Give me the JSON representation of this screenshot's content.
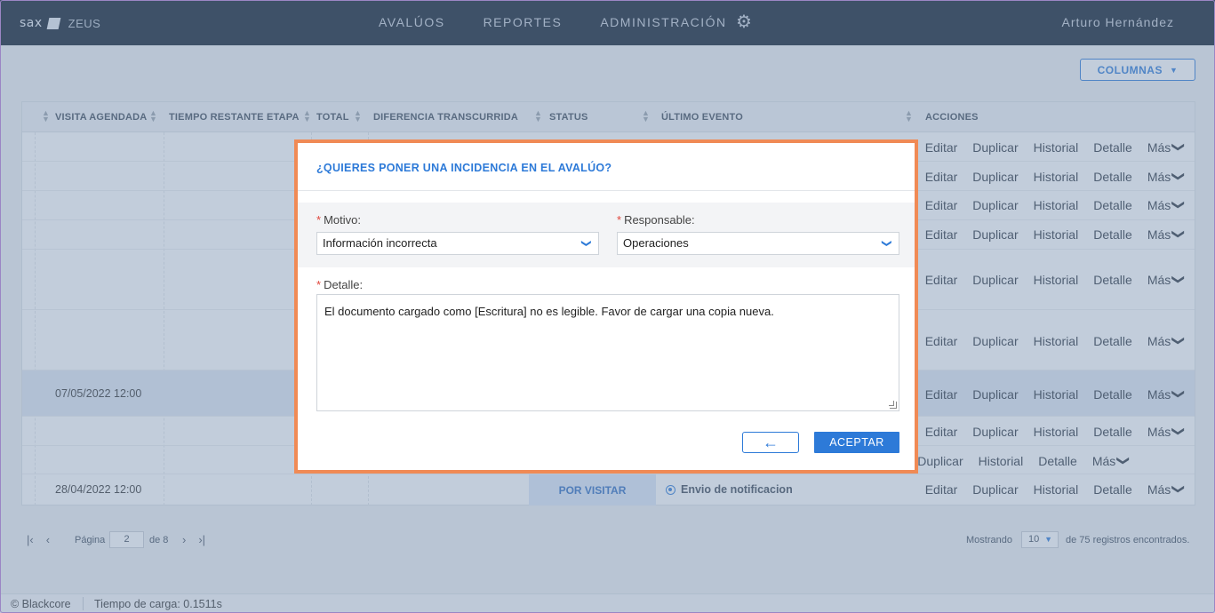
{
  "header": {
    "logo": "sax",
    "app": "ZEUS",
    "nav": [
      "AVALÚOS",
      "REPORTES",
      "ADMINISTRACIÓN"
    ],
    "user": "Arturo Hernández",
    "settings_icon": "gear-icon"
  },
  "toolbar": {
    "columns_label": "COLUMNAS"
  },
  "table": {
    "headers": [
      "VISITA AGENDADA",
      "TIEMPO RESTANTE ETAPA",
      "TOTAL",
      "DIFERENCIA TRANSCURRIDA",
      "STATUS",
      "ÚLTIMO EVENTO",
      "ACCIONES"
    ],
    "actions": [
      "Editar",
      "Duplicar",
      "Historial",
      "Detalle",
      "Más"
    ],
    "rows": [
      {
        "visita": "",
        "actions": [
          "Editar",
          "Duplicar",
          "Historial",
          "Detalle",
          "Más"
        ]
      },
      {
        "visita": "",
        "actions": [
          "Editar",
          "Duplicar",
          "Historial",
          "Detalle",
          "Más"
        ]
      },
      {
        "visita": "",
        "actions": [
          "Editar",
          "Duplicar",
          "Historial",
          "Detalle",
          "Más"
        ]
      },
      {
        "visita": "",
        "actions": [
          "Editar",
          "Duplicar",
          "Historial",
          "Detalle",
          "Más"
        ]
      },
      {
        "visita": "",
        "actions": [
          "Editar",
          "Duplicar",
          "Historial",
          "Detalle",
          "Más"
        ]
      },
      {
        "visita": "",
        "actions": [
          "Editar",
          "Duplicar",
          "Historial",
          "Detalle",
          "Más"
        ]
      },
      {
        "visita": "07/05/2022 12:00",
        "actions": [
          "Editar",
          "Duplicar",
          "Historial",
          "Detalle",
          "Más"
        ]
      },
      {
        "visita": "",
        "actions": [
          "Editar",
          "Duplicar",
          "Historial",
          "Detalle",
          "Más"
        ]
      },
      {
        "visita": "",
        "actions": [
          "Duplicar",
          "Historial",
          "Detalle",
          "Más"
        ]
      },
      {
        "visita": "28/04/2022 12:00",
        "status": "POR VISITAR",
        "evento": "Envio de notificacion",
        "actions": [
          "Editar",
          "Duplicar",
          "Historial",
          "Detalle",
          "Más"
        ]
      }
    ]
  },
  "pager": {
    "page_label": "Página",
    "page": "2",
    "of": "de 8",
    "showing": "Mostrando",
    "per_page": "10",
    "found": "de 75 registros encontrados."
  },
  "footer": {
    "copyright": "© Blackcore",
    "load_time": "Tiempo de carga: 0.1511s"
  },
  "modal": {
    "title": "¿QUIERES PONER UNA INCIDENCIA EN EL AVALÚO?",
    "required_mark": "*",
    "motivo_label": "Motivo:",
    "motivo_value": "Información incorrecta",
    "responsable_label": "Responsable:",
    "responsable_value": "Operaciones",
    "detalle_label": "Detalle:",
    "detalle_value": "El documento cargado como [Escritura] no es legible. Favor de cargar una copia nueva.",
    "back_icon": "arrow-left-icon",
    "accept_label": "ACEPTAR"
  },
  "colors": {
    "accent": "#2d7ad8",
    "modal_border": "#f08a55",
    "nav_bg": "#0c1a2b",
    "required": "#e0463c"
  }
}
